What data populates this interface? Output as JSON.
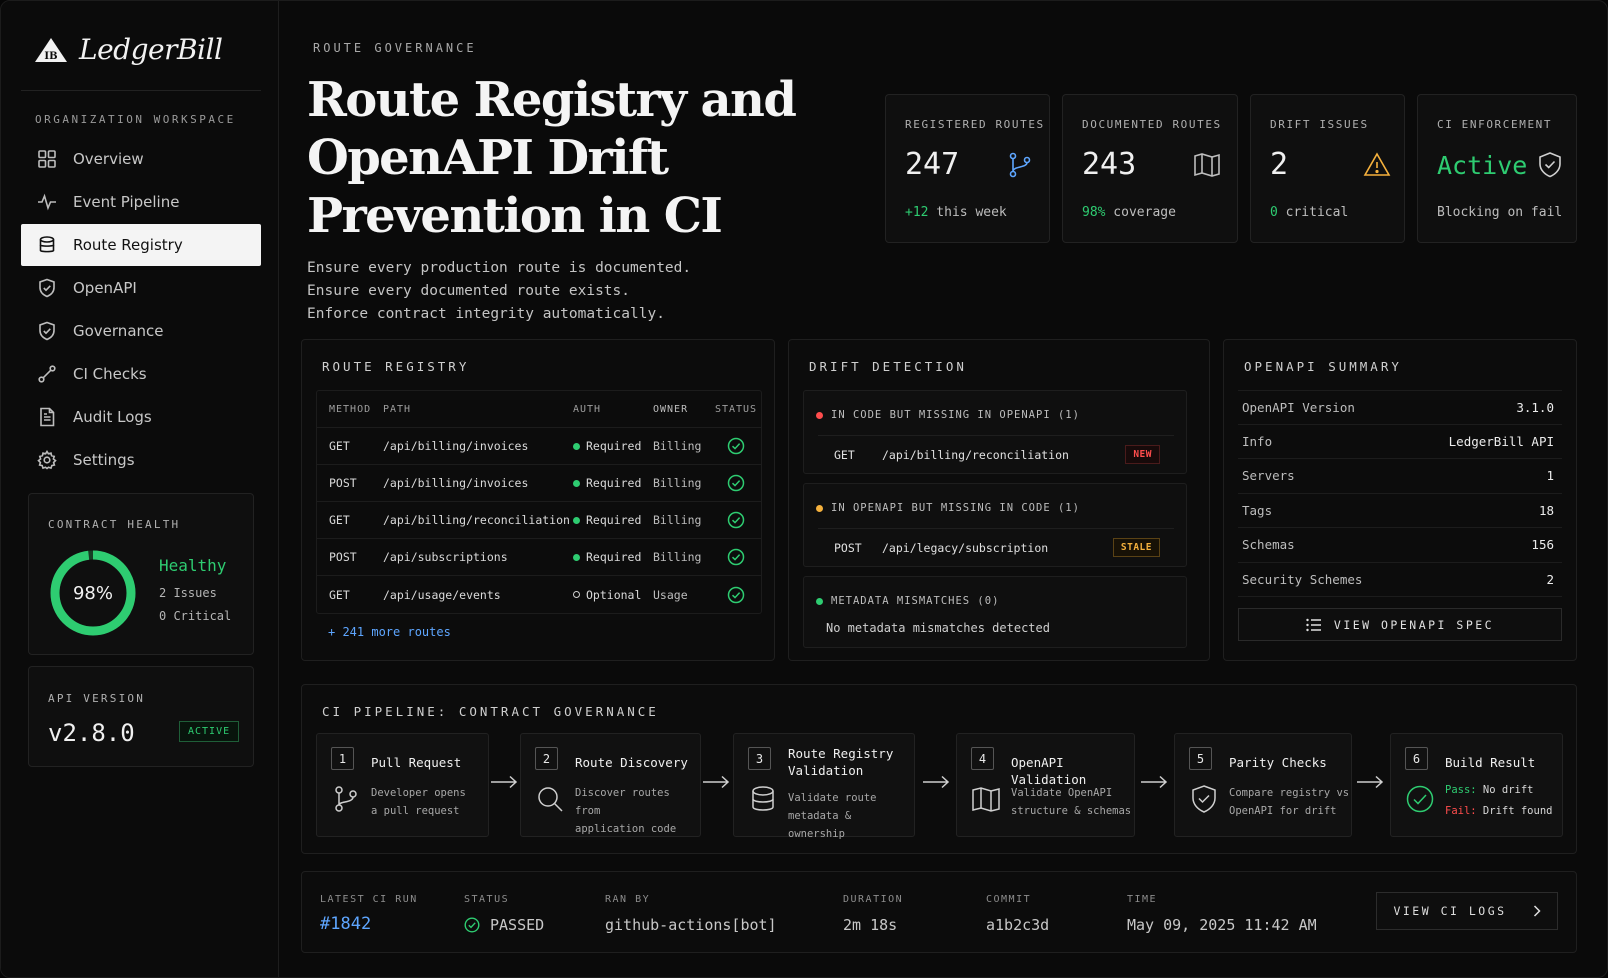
{
  "brand": {
    "logo_mark": "IB",
    "name": "LedgerBill"
  },
  "sidebar": {
    "section_label": "ORGANIZATION WORKSPACE",
    "items": [
      {
        "label": "Overview",
        "icon": "grid-icon",
        "active": false
      },
      {
        "label": "Event Pipeline",
        "icon": "pulse-icon",
        "active": false
      },
      {
        "label": "Route Registry",
        "icon": "database-icon",
        "active": true
      },
      {
        "label": "OpenAPI",
        "icon": "shield-check-icon",
        "active": false
      },
      {
        "label": "Governance",
        "icon": "shield-icon",
        "active": false
      },
      {
        "label": "CI Checks",
        "icon": "route-icon",
        "active": false
      },
      {
        "label": "Audit Logs",
        "icon": "document-icon",
        "active": false
      },
      {
        "label": "Settings",
        "icon": "gear-icon",
        "active": false
      }
    ],
    "contract_health": {
      "label": "CONTRACT HEALTH",
      "percent": 98,
      "percent_label": "98%",
      "status": "Healthy",
      "issues": "2 Issues",
      "critical": "0 Critical"
    },
    "api_version": {
      "label": "API VERSION",
      "value": "v2.8.0",
      "badge": "ACTIVE"
    }
  },
  "header": {
    "eyebrow": "ROUTE GOVERNANCE",
    "title": "Route Registry and OpenAPI Drift Prevention in CI",
    "subtitle": [
      "Ensure every production route is documented.",
      "Ensure every documented route exists.",
      "Enforce contract integrity automatically."
    ]
  },
  "stats": [
    {
      "label": "REGISTERED ROUTES",
      "value": "247",
      "sub_highlight": "+12",
      "sub_rest": " this week",
      "icon": "route-branch-icon",
      "accent": "#5ea6ff"
    },
    {
      "label": "DOCUMENTED ROUTES",
      "value": "243",
      "sub_highlight": "98%",
      "sub_rest": " coverage",
      "icon": "book-map-icon",
      "accent": "#bdbdbd"
    },
    {
      "label": "DRIFT ISSUES",
      "value": "2",
      "sub_highlight": "0",
      "sub_rest": " critical",
      "icon": "warning-icon",
      "accent": "#f5b13d"
    },
    {
      "label": "CI ENFORCEMENT",
      "value": "Active",
      "sub_highlight": "",
      "sub_rest": "Blocking on fail",
      "icon": "shield-check-icon",
      "accent": "#cfcfcf"
    }
  ],
  "registry": {
    "title": "ROUTE REGISTRY",
    "columns": [
      "METHOD",
      "PATH",
      "AUTH",
      "OWNER",
      "STATUS"
    ],
    "rows": [
      {
        "method": "GET",
        "path": "/api/billing/invoices",
        "auth": "Required",
        "owner": "Billing",
        "status": "ok"
      },
      {
        "method": "POST",
        "path": "/api/billing/invoices",
        "auth": "Required",
        "owner": "Billing",
        "status": "ok"
      },
      {
        "method": "GET",
        "path": "/api/billing/reconciliation",
        "auth": "Required",
        "owner": "Billing",
        "status": "ok"
      },
      {
        "method": "POST",
        "path": "/api/subscriptions",
        "auth": "Required",
        "owner": "Billing",
        "status": "ok"
      },
      {
        "method": "GET",
        "path": "/api/usage/events",
        "auth": "Optional",
        "owner": "Usage",
        "status": "ok"
      }
    ],
    "more_link": "+ 241 more routes"
  },
  "drift": {
    "title": "DRIFT DETECTION",
    "missing_openapi": {
      "label": "IN CODE BUT MISSING IN OPENAPI (1)",
      "method": "GET",
      "path": "/api/billing/reconciliation",
      "tag": "NEW",
      "dot": "#ff4d4d"
    },
    "missing_code": {
      "label": "IN OPENAPI BUT MISSING IN CODE (1)",
      "method": "POST",
      "path": "/api/legacy/subscription",
      "tag": "STALE",
      "dot": "#f5b13d"
    },
    "metadata": {
      "label": "METADATA MISMATCHES (0)",
      "message": "No metadata mismatches detected",
      "dot": "#2ecc71"
    }
  },
  "openapi": {
    "title": "OPENAPI SUMMARY",
    "rows": [
      {
        "key": "OpenAPI Version",
        "value": "3.1.0"
      },
      {
        "key": "Info",
        "value": "LedgerBill API"
      },
      {
        "key": "Servers",
        "value": "1"
      },
      {
        "key": "Tags",
        "value": "18"
      },
      {
        "key": "Schemas",
        "value": "156"
      },
      {
        "key": "Security Schemes",
        "value": "2"
      }
    ],
    "button": "VIEW OPENAPI SPEC"
  },
  "pipeline": {
    "title": "CI PIPELINE: CONTRACT GOVERNANCE",
    "steps": [
      {
        "num": "1",
        "title": "Pull Request",
        "desc1": "Developer opens",
        "desc2": "a pull request",
        "icon": "git-branch-icon"
      },
      {
        "num": "2",
        "title": "Route Discovery",
        "desc1": "Discover routes from",
        "desc2": "application code",
        "icon": "search-icon"
      },
      {
        "num": "3",
        "title1": "Route Registry",
        "title2": "Validation",
        "desc1": "Validate route",
        "desc2": "metadata & ownership",
        "icon": "database-icon"
      },
      {
        "num": "4",
        "title": "OpenAPI Validation",
        "desc1": "Validate OpenAPI",
        "desc2": "structure & schemas",
        "icon": "book-map-icon"
      },
      {
        "num": "5",
        "title": "Parity Checks",
        "desc1": "Compare registry vs",
        "desc2": "OpenAPI for drift",
        "icon": "shield-check-icon"
      },
      {
        "num": "6",
        "title": "Build Result",
        "pass_label": "Pass:",
        "pass_text": " No drift",
        "fail_label": "Fail:",
        "fail_text": " Drift found",
        "icon": "check-circle-icon"
      }
    ]
  },
  "latest_run": {
    "run_label": "LATEST CI RUN",
    "run_value": "#1842",
    "status_label": "STATUS",
    "status_value": "PASSED",
    "ranby_label": "RAN BY",
    "ranby_value": "github-actions[bot]",
    "duration_label": "DURATION",
    "duration_value": "2m 18s",
    "commit_label": "COMMIT",
    "commit_value": "a1b2c3d",
    "time_label": "TIME",
    "time_value": "May 09, 2025 11:42 AM",
    "button": "VIEW CI LOGS"
  },
  "colors": {
    "green": "#2ecc71",
    "blue": "#5ea6ff",
    "amber": "#f5b13d",
    "red": "#ff4d4d"
  }
}
